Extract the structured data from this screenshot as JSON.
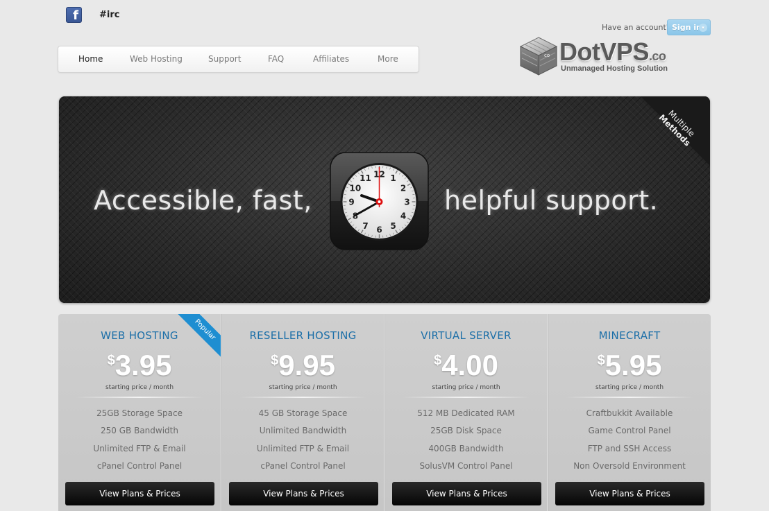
{
  "header": {
    "facebook_icon": "facebook-icon",
    "irc_label": "#irc",
    "account_prompt": "Have an account?",
    "signin_label": "Sign in",
    "signin_caret": "▾"
  },
  "logo": {
    "name": "DotVPS",
    "suffix": ".co",
    "tagline": "Unmanaged Hosting Solution",
    "badge": "co"
  },
  "nav": {
    "items": [
      "Home",
      "Web Hosting",
      "Support",
      "FAQ",
      "Affiliates",
      "More"
    ],
    "active": "Home"
  },
  "banner": {
    "text_left": "Accessible, fast,",
    "text_right": "helpful support.",
    "corner_line1": "Multiple",
    "corner_line2": "Methods",
    "clock_numbers": [
      "12",
      "1",
      "2",
      "3",
      "4",
      "5",
      "6",
      "7",
      "8",
      "9",
      "10",
      "11"
    ]
  },
  "plans": [
    {
      "title": "WEB HOSTING",
      "currency": "$",
      "price": "3.95",
      "period": "starting price / month",
      "features": [
        "25GB Storage Space",
        "250 GB Bandwidth",
        "Unlimited FTP & Email",
        "cPanel Control Panel"
      ],
      "button": "View Plans & Prices",
      "badge": "Popular"
    },
    {
      "title": "RESELLER HOSTING",
      "currency": "$",
      "price": "9.95",
      "period": "starting price / month",
      "features": [
        "45 GB Storage Space",
        "Unlimited Bandwidth",
        "Unlimited FTP & Email",
        "cPanel Control Panel"
      ],
      "button": "View Plans & Prices"
    },
    {
      "title": "VIRTUAL SERVER",
      "currency": "$",
      "price": "4.00",
      "period": "starting price / month",
      "features": [
        "512 MB Dedicated RAM",
        "25GB Disk Space",
        "400GB Bandwidth",
        "SolusVM Control Panel"
      ],
      "button": "View Plans & Prices"
    },
    {
      "title": "MINECRAFT",
      "currency": "$",
      "price": "5.95",
      "period": "starting price / month",
      "features": [
        "Craftbukkit Available",
        "Game Control Panel",
        "FTP and SSH Access",
        "Non Oversold Environment"
      ],
      "button": "View Plans & Prices"
    }
  ],
  "colors": {
    "accent_blue": "#1c6fa8",
    "ribbon_blue": "#1e8ed1",
    "signin_blue": "#8bc6e9",
    "background": "#e9e9e9"
  }
}
